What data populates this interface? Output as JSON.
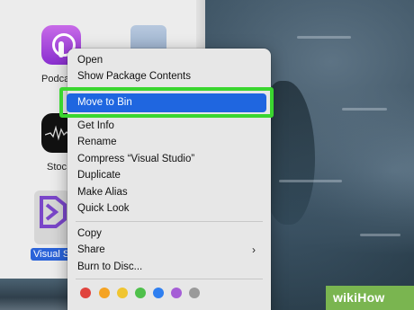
{
  "finder": {
    "items": [
      {
        "label": "Podcas"
      },
      {
        "label": ""
      },
      {
        "label": "Stoc"
      },
      {
        "label": "Visual S"
      }
    ]
  },
  "context_menu": {
    "items": [
      "Open",
      "Show Package Contents",
      "Move to Bin",
      "Get Info",
      "Rename",
      "Compress “Visual Studio”",
      "Duplicate",
      "Make Alias",
      "Quick Look",
      "Copy",
      "Share",
      "Burn to Disc..."
    ],
    "highlighted_item": "Move to Bin",
    "submenu_arrow": "›",
    "tag_colors": [
      "#e0443e",
      "#f5a323",
      "#f0c531",
      "#4fc04b",
      "#2f7ff0",
      "#a55ed6",
      "#9a9a9a"
    ]
  },
  "annotation": {
    "highlight_color": "#3ad62f"
  },
  "watermark": {
    "text": "wikiHow"
  }
}
